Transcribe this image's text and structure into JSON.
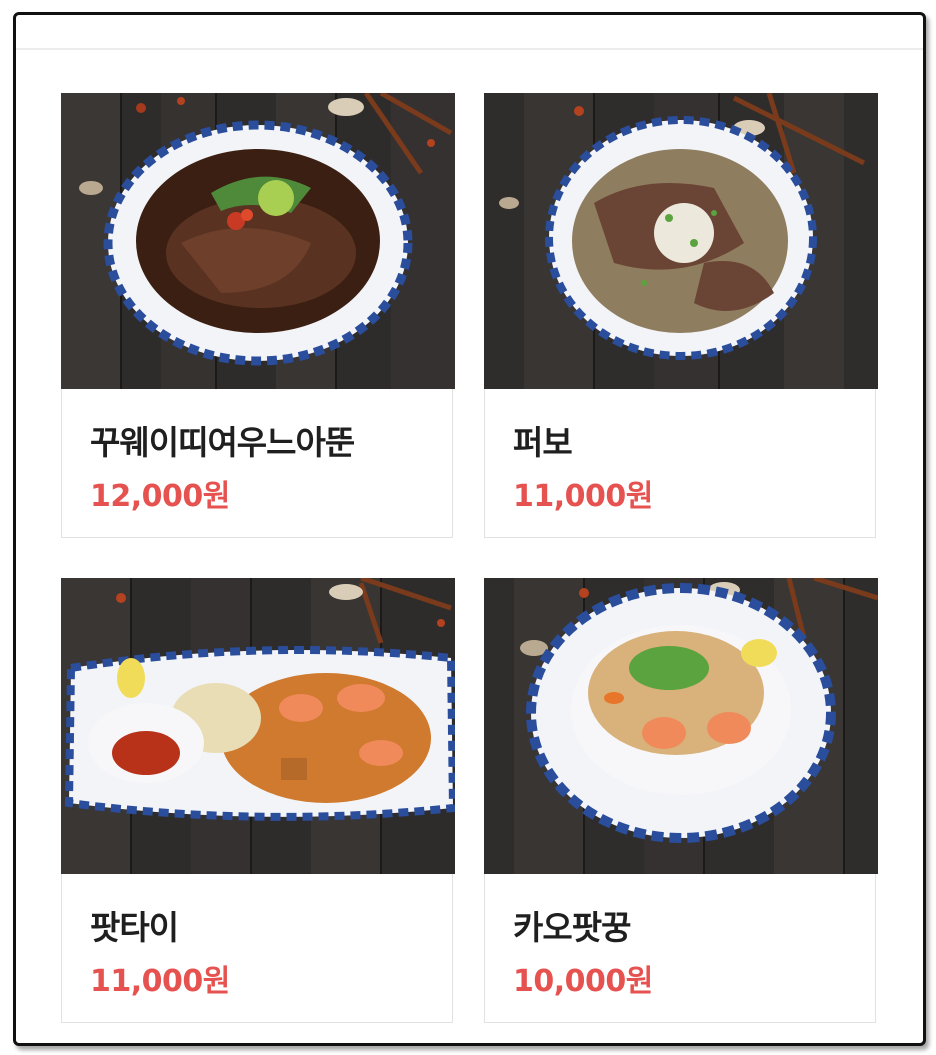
{
  "menu": {
    "items": [
      {
        "name": "꾸웨이띠여우느아뚠",
        "price": "12,000원",
        "photo": "beef-noodle-soup-photo"
      },
      {
        "name": "퍼보",
        "price": "11,000원",
        "photo": "pho-bo-photo"
      },
      {
        "name": "팟타이",
        "price": "11,000원",
        "photo": "pad-thai-photo"
      },
      {
        "name": "카오팟꿍",
        "price": "10,000원",
        "photo": "shrimp-fried-rice-photo"
      }
    ]
  },
  "colors": {
    "price": "#e5524f",
    "name": "#1f1f1f",
    "card_border": "#e2e2e2",
    "frame_border": "#111111"
  }
}
